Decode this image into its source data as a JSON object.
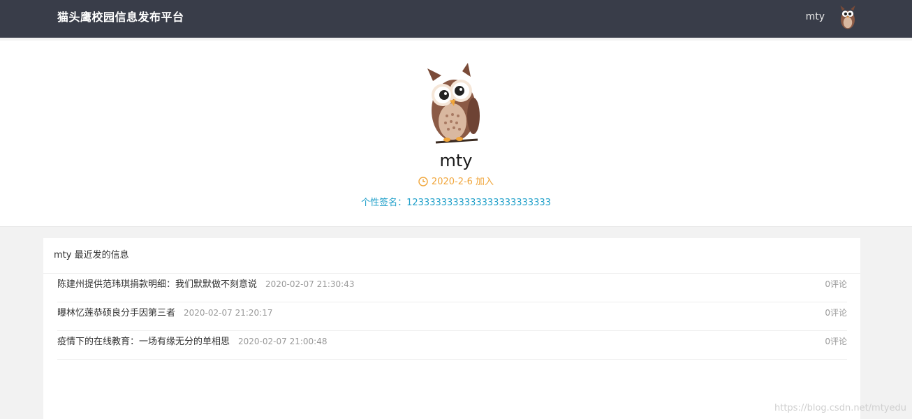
{
  "header": {
    "brand": "猫头鹰校园信息发布平台",
    "username": "mty"
  },
  "profile": {
    "name": "mty",
    "join_date": "2020-2-6 加入",
    "signature": "个性签名：1233333333333333333333333"
  },
  "posts": {
    "title": "mty 最近发的信息",
    "items": [
      {
        "title": "陈建州提供范玮琪捐款明细：我们默默做不刻意说",
        "time": "2020-02-07 21:30:43",
        "comments": "0评论"
      },
      {
        "title": "曝林忆莲恭硕良分手因第三者",
        "time": "2020-02-07 21:20:17",
        "comments": "0评论"
      },
      {
        "title": "疫情下的在线教育：一场有缘无分的单相思",
        "time": "2020-02-07 21:00:48",
        "comments": "0评论"
      }
    ]
  },
  "watermark": "https://blog.csdn.net/mtyedu",
  "colors": {
    "header_bg": "#393d49",
    "join_text": "#f0a53a",
    "signature_text": "#1e9fc9",
    "owl_brown": "#8b5a45"
  }
}
